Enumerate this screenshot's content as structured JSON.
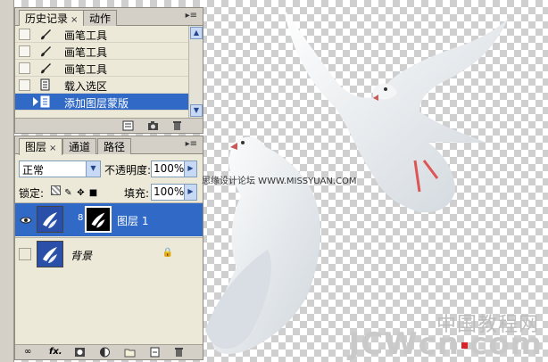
{
  "history_panel": {
    "tabs": [
      {
        "label": "历史记录",
        "close": "×"
      },
      {
        "label": "动作"
      }
    ],
    "menu_glyph": "▸≡",
    "items": [
      {
        "label": "画笔工具",
        "icon": "brush-icon"
      },
      {
        "label": "画笔工具",
        "icon": "brush-icon"
      },
      {
        "label": "画笔工具",
        "icon": "brush-icon"
      },
      {
        "label": "载入选区",
        "icon": "document-icon"
      },
      {
        "label": "添加图层蒙版",
        "icon": "document-icon",
        "selected": true
      }
    ]
  },
  "layers_panel": {
    "tabs": [
      {
        "label": "图层",
        "close": "×"
      },
      {
        "label": "通道"
      },
      {
        "label": "路径"
      }
    ],
    "menu_glyph": "▸≡",
    "blend_mode": "正常",
    "opacity_label": "不透明度:",
    "opacity_value": "100%",
    "lock_label": "锁定:",
    "fill_label": "填充:",
    "fill_value": "100%",
    "layers": [
      {
        "name": "图层 1",
        "visible": true,
        "selected": true,
        "has_mask": true
      },
      {
        "name": "背景",
        "visible": false,
        "selected": false,
        "locked": true
      }
    ]
  },
  "watermark": {
    "site_text": "思缘设计论坛  WWW.MISSYUAN.COM",
    "logo_top": "中国教程网",
    "logo_bottom_a": "JCWcn",
    "logo_bottom_b": "com"
  },
  "colors": {
    "selection": "#3169c6",
    "panel_bg": "#ece9d8"
  }
}
